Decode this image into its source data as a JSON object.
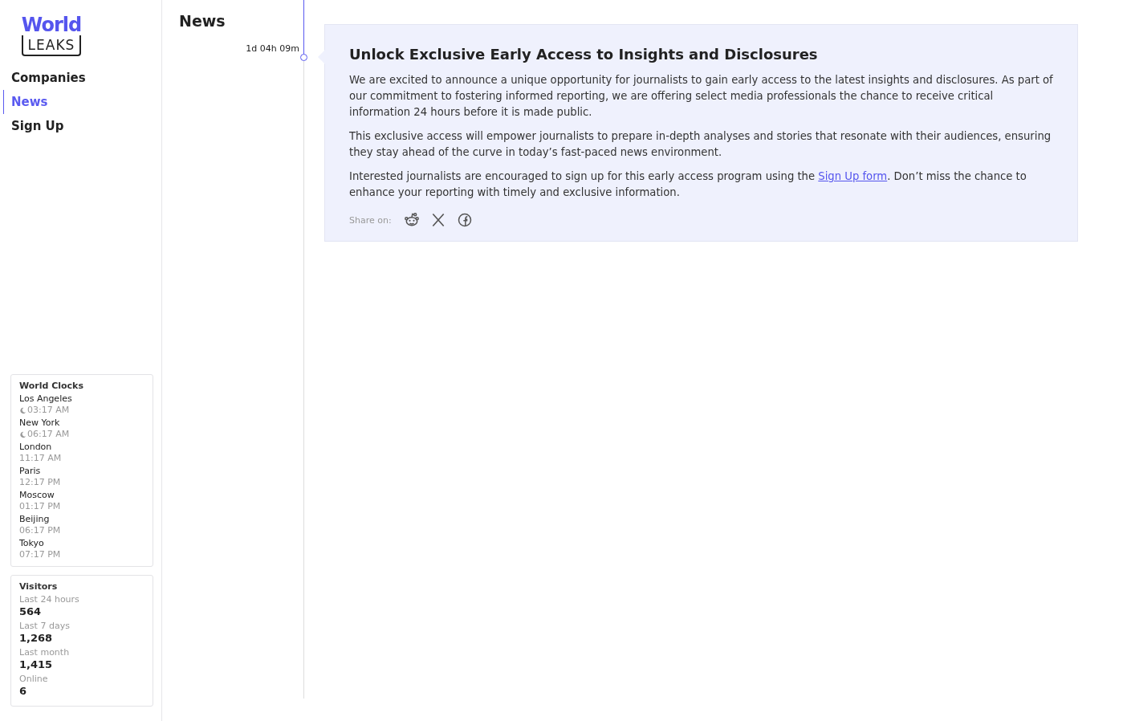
{
  "logo": {
    "top": "World",
    "bottom": "LEAKS"
  },
  "nav": [
    {
      "label": "Companies",
      "selected": false
    },
    {
      "label": "News",
      "selected": true
    },
    {
      "label": "Sign Up",
      "selected": false
    }
  ],
  "clocks": {
    "title": "World Clocks",
    "items": [
      {
        "city": "Los Angeles",
        "time": "03:17 AM",
        "night": true
      },
      {
        "city": "New York",
        "time": "06:17 AM",
        "night": true
      },
      {
        "city": "London",
        "time": "11:17 AM",
        "night": false
      },
      {
        "city": "Paris",
        "time": "12:17 PM",
        "night": false
      },
      {
        "city": "Moscow",
        "time": "01:17 PM",
        "night": false
      },
      {
        "city": "Beijing",
        "time": "06:17 PM",
        "night": false
      },
      {
        "city": "Tokyo",
        "time": "07:17 PM",
        "night": false
      }
    ]
  },
  "visitors": {
    "title": "Visitors",
    "items": [
      {
        "label": "Last 24 hours",
        "value": "564"
      },
      {
        "label": "Last 7 days",
        "value": "1,268"
      },
      {
        "label": "Last month",
        "value": "1,415"
      },
      {
        "label": "Online",
        "value": "6"
      }
    ]
  },
  "page_title": "News",
  "posts": [
    {
      "time": "1d 04h 09m",
      "title": "Unlock Exclusive Early Access to Insights and Disclosures",
      "paragraphs": [
        {
          "text": "We are excited to announce a unique opportunity for journalists to gain early access to the latest insights and disclosures. As part of our commitment to fostering informed reporting, we are offering select media professionals the chance to receive critical information 24 hours before it is made public."
        },
        {
          "text": "This exclusive access will empower journalists to prepare in-depth analyses and stories that resonate with their audiences, ensuring they stay ahead of the curve in today’s fast-paced news environment."
        },
        {
          "text": "Interested journalists are encouraged to sign up for this early access program using the ",
          "link": "Sign Up form",
          "after": ". Don’t miss the chance to enhance your reporting with timely and exclusive information."
        }
      ],
      "share_label": "Share on:"
    }
  ]
}
